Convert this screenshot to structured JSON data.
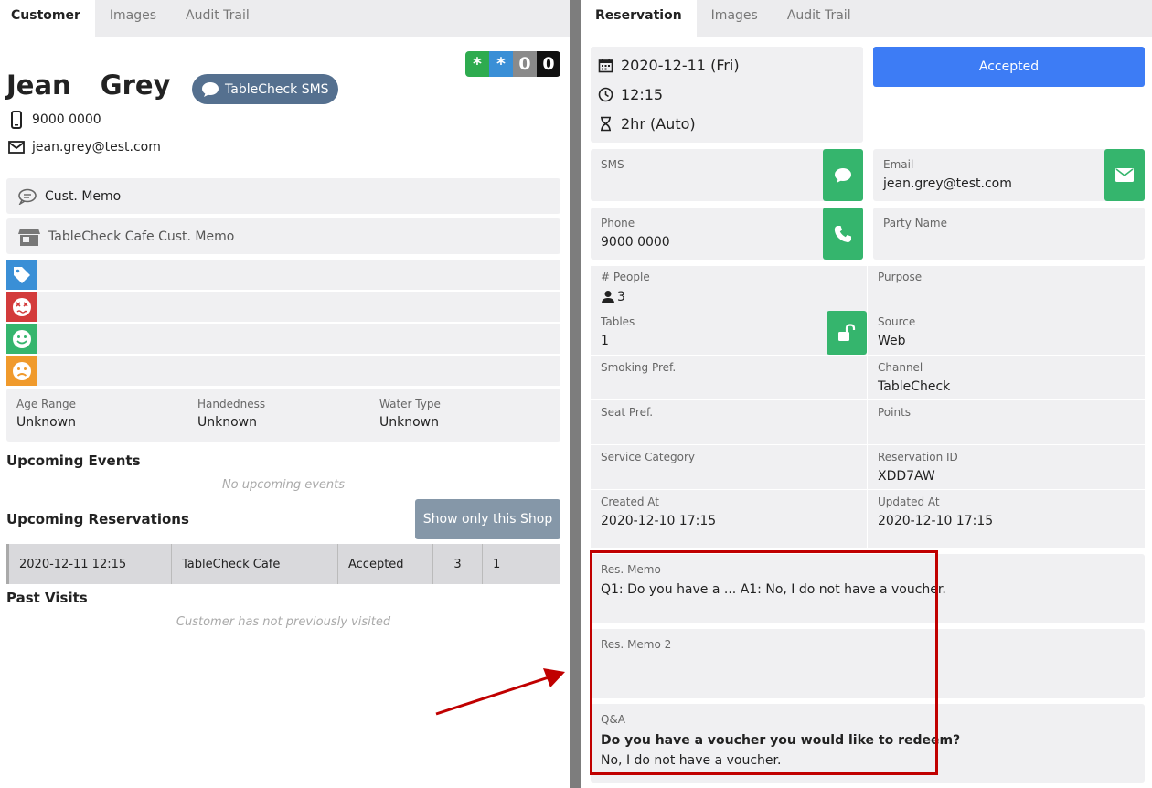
{
  "left": {
    "tabs": [
      "Customer",
      "Images",
      "Audit Trail"
    ],
    "badges": [
      "*",
      "*",
      "0",
      "0"
    ],
    "customer_name": "Jean Grey",
    "sms_button": "TableCheck SMS",
    "phone": "9000 0000",
    "email": "jean.grey@test.com",
    "cust_memo": "Cust. Memo",
    "shop_memo": "TableCheck Cafe Cust. Memo",
    "tag_icons": [
      "tag-icon",
      "dizzy-face-icon",
      "smile-icon",
      "frown-icon"
    ],
    "attributes": [
      {
        "label": "Age Range",
        "value": "Unknown"
      },
      {
        "label": "Handedness",
        "value": "Unknown"
      },
      {
        "label": "Water Type",
        "value": "Unknown"
      }
    ],
    "upcoming_events_title": "Upcoming Events",
    "no_events": "No upcoming events",
    "upcoming_res_title": "Upcoming Reservations",
    "show_only_button": "Show only this Shop",
    "reservation_row": {
      "datetime": "2020-12-11 12:15",
      "shop": "TableCheck Cafe",
      "status": "Accepted",
      "people": "3",
      "tables": "1"
    },
    "past_visits_title": "Past Visits",
    "no_visits": "Customer has not previously visited"
  },
  "right": {
    "tabs": [
      "Reservation",
      "Images",
      "Audit Trail"
    ],
    "date": "2020-12-11 (Fri)",
    "time": "12:15",
    "duration": "2hr (Auto)",
    "status": "Accepted",
    "sms_label": "SMS",
    "email_label": "Email",
    "email_value": "jean.grey@test.com",
    "phone_label": "Phone",
    "phone_value": "9000 0000",
    "party_label": "Party Name",
    "people_label": "# People",
    "people_value": "3",
    "purpose_label": "Purpose",
    "tables_label": "Tables",
    "tables_value": "1",
    "source_label": "Source",
    "source_value": "Web",
    "smoking_label": "Smoking Pref.",
    "channel_label": "Channel",
    "channel_value": "TableCheck",
    "seat_label": "Seat Pref.",
    "points_label": "Points",
    "service_label": "Service Category",
    "resid_label": "Reservation ID",
    "resid_value": "XDD7AW",
    "created_label": "Created At",
    "created_value": "2020-12-10 17:15",
    "updated_label": "Updated At",
    "updated_value": "2020-12-10 17:15",
    "res_memo_label": "Res. Memo",
    "res_memo_value": "Q1: Do you have a ... A1: No, I do not have a voucher.",
    "res_memo2_label": "Res. Memo 2",
    "qa_label": "Q&A",
    "qa_question": "Do you have a voucher you would like to redeem?",
    "qa_answer": "No, I do not have a voucher."
  },
  "colors": {
    "accepted_blue": "#3d7cf5",
    "action_green": "#35b56d",
    "highlight_red": "#c00000"
  }
}
